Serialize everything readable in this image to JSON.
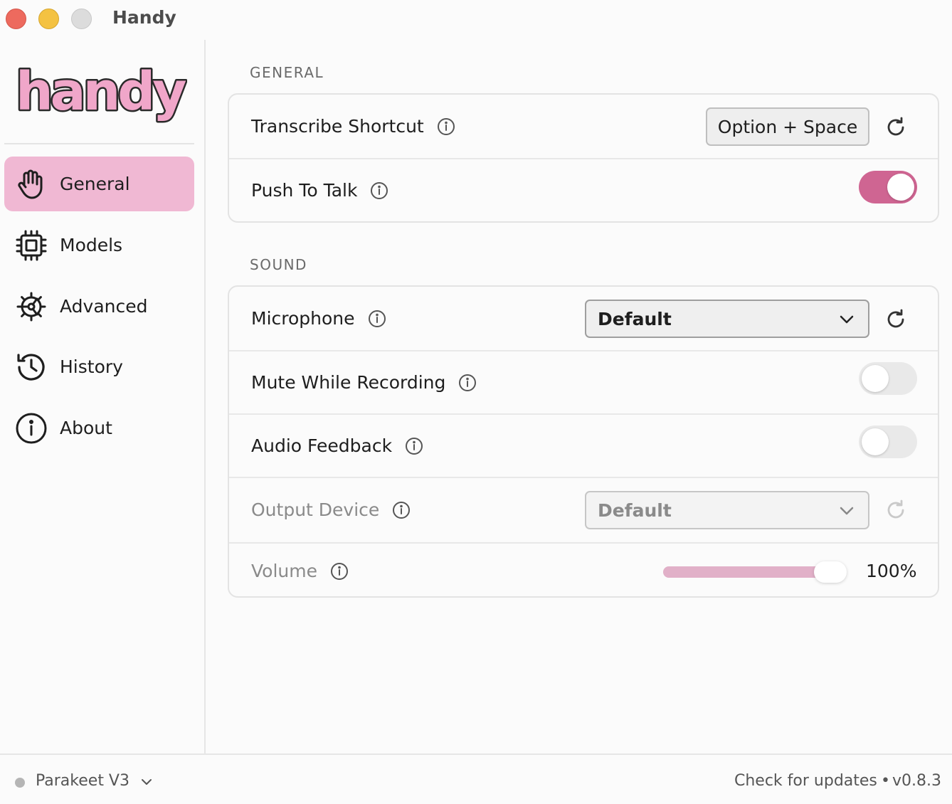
{
  "window": {
    "title": "Handy"
  },
  "brand": {
    "logo_text": "handy",
    "logo_fill": "#f0a6c9",
    "logo_stroke": "#2a2a2a"
  },
  "sidebar": {
    "items": [
      {
        "label": "General",
        "icon": "hand-icon",
        "active": true
      },
      {
        "label": "Models",
        "icon": "chip-icon",
        "active": false
      },
      {
        "label": "Advanced",
        "icon": "gear-icon",
        "active": false
      },
      {
        "label": "History",
        "icon": "history-icon",
        "active": false
      },
      {
        "label": "About",
        "icon": "info-icon",
        "active": false
      }
    ]
  },
  "sections": {
    "general": {
      "title": "GENERAL",
      "transcribe_shortcut": {
        "label": "Transcribe Shortcut",
        "value": "Option + Space"
      },
      "push_to_talk": {
        "label": "Push To Talk",
        "enabled": true
      }
    },
    "sound": {
      "title": "SOUND",
      "microphone": {
        "label": "Microphone",
        "value": "Default"
      },
      "mute_while_recording": {
        "label": "Mute While Recording",
        "enabled": false
      },
      "audio_feedback": {
        "label": "Audio Feedback",
        "enabled": false
      },
      "output_device": {
        "label": "Output Device",
        "value": "Default"
      },
      "volume": {
        "label": "Volume",
        "value_text": "100%",
        "fraction": 1.0
      }
    }
  },
  "footer": {
    "model": "Parakeet V3",
    "check_updates": "Check for updates",
    "separator": "•",
    "version": "v0.8.3"
  },
  "colors": {
    "accent": "#cf6592",
    "nav_active_bg": "#f0b8d3",
    "slider_fill": "#e1b0c8"
  }
}
